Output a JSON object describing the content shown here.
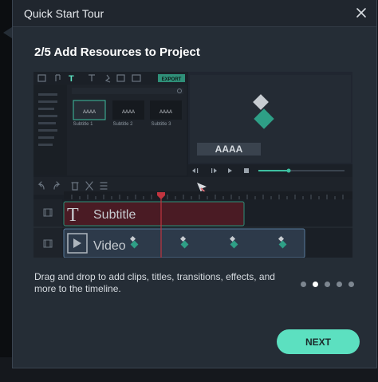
{
  "dialog": {
    "title": "Quick Start Tour",
    "step_title": "2/5 Add Resources to Project",
    "description": "Drag and drop to add clips, titles, transitions, effects, and more to the timeline.",
    "next_label": "NEXT",
    "step_current": 2,
    "step_total": 5
  },
  "preview": {
    "export_label": "EXPORT",
    "media_tiles": [
      {
        "text": "AAAA",
        "label": "Subtitle 1"
      },
      {
        "text": "AAAA",
        "label": "Subtitle 2"
      },
      {
        "text": "AAAA",
        "label": "Subtitle 3"
      }
    ],
    "player_caption": "AAAA",
    "subtitle_track_label": "Subtitle",
    "video_track_label": "Video",
    "title_glyph": "T"
  },
  "colors": {
    "accent": "#5ce0c0",
    "clip_subtitle": "#4a1b24",
    "clip_video": "#2d3a4a"
  }
}
